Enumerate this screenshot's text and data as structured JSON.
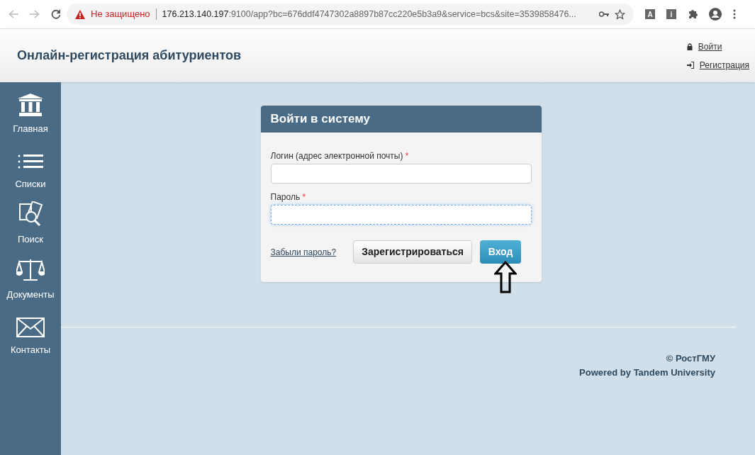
{
  "browser": {
    "security": "Не защищено",
    "url_host": "176.213.140.197",
    "url_rest": ":9100/app?bc=676ddf4747302a8897b87cc220e5b3a9&service=bcs&site=3539858476...",
    "extensions": [
      "A",
      "i"
    ]
  },
  "header": {
    "title": "Онлайн-регистрация абитуриентов",
    "links": [
      {
        "kind": "lock",
        "label": "Войти"
      },
      {
        "kind": "signin",
        "label": "Регистрация"
      }
    ]
  },
  "sidebar": {
    "items": [
      {
        "kind": "home",
        "label": "Главная"
      },
      {
        "kind": "list",
        "label": "Списки"
      },
      {
        "kind": "search",
        "label": "Поиск"
      },
      {
        "kind": "scales",
        "label": "Документы"
      },
      {
        "kind": "mail",
        "label": "Контакты"
      }
    ]
  },
  "login": {
    "title": "Войти в систему",
    "fields": [
      {
        "label": "Логин (адрес электронной почты)",
        "required_mark": "*",
        "focused": false
      },
      {
        "label": "Пароль",
        "required_mark": "*",
        "focused": true
      }
    ],
    "forgot_link": "Забыли пароль?",
    "register_button": "Зарегистрироваться",
    "login_button": "Вход"
  },
  "footer": {
    "copyright": "© РостГМУ",
    "powered": "Powered by Tandem University"
  }
}
